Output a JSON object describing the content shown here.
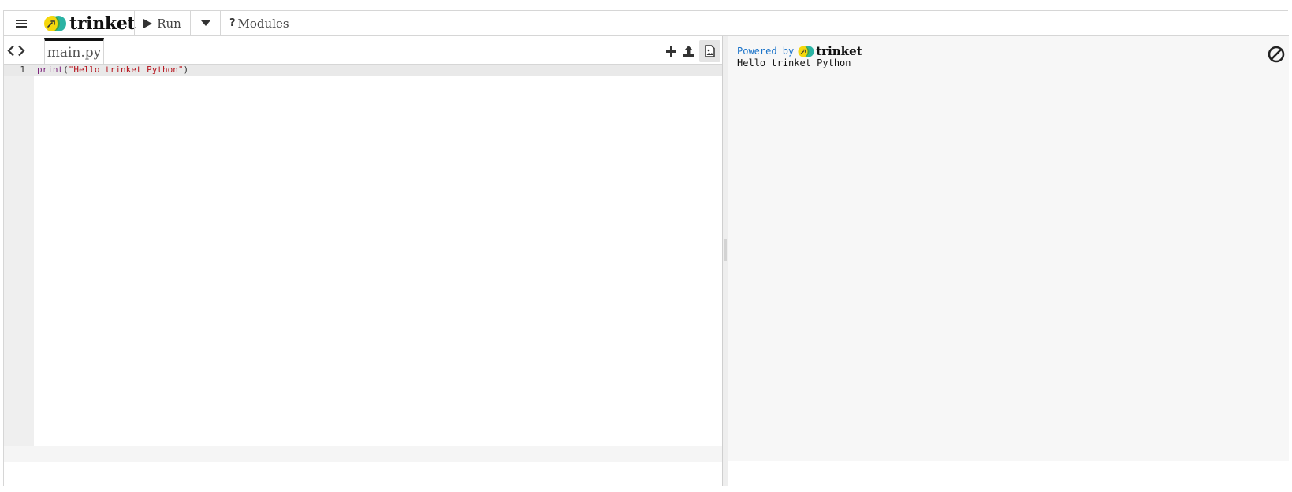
{
  "topbar": {
    "menu_icon": "hamburger-menu-icon",
    "brand": "trinket",
    "run_label": "Run",
    "modules_label": "Modules"
  },
  "editor": {
    "file_tab": "main.py",
    "line_numbers": [
      "1"
    ],
    "code": {
      "builtin": "print",
      "open_paren": "(",
      "string": "\"Hello trinket Python\"",
      "close_paren": ")"
    },
    "actions": [
      "add-file-icon",
      "upload-icon",
      "image-icon"
    ]
  },
  "output": {
    "powered_label": "Powered by",
    "powered_brand": "trinket",
    "text": "Hello trinket Python",
    "clear_icon": "block-icon"
  },
  "colors": {
    "logo_yellow": "#f5d70c",
    "logo_teal": "#2bb3a4",
    "logo_green": "#3aa54a",
    "powered_blue": "#1a73c9",
    "string_red": "#b5121b",
    "builtin_purple": "#7a1f7a"
  }
}
